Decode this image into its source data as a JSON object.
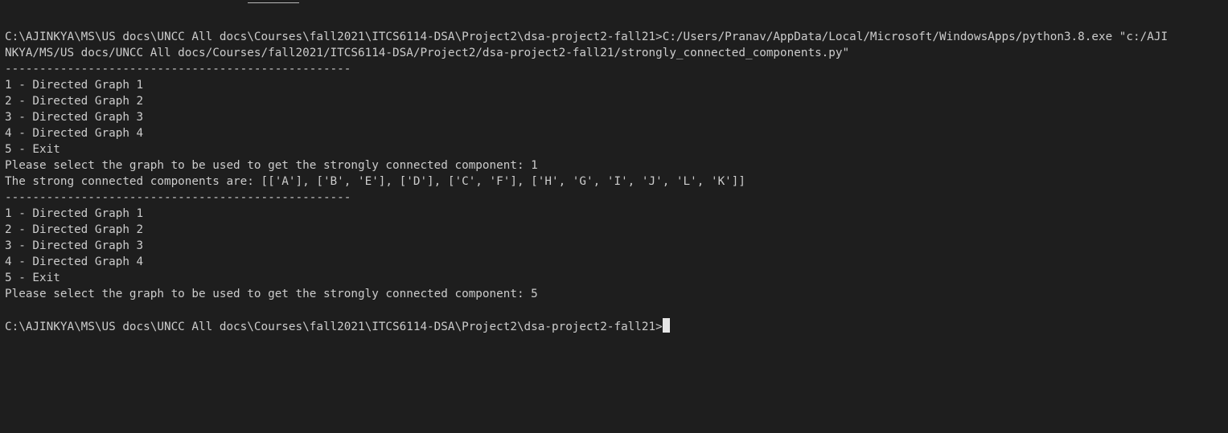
{
  "terminal": {
    "command_line_1": "C:\\AJINKYA\\MS\\US docs\\UNCC All docs\\Courses\\fall2021\\ITCS6114-DSA\\Project2\\dsa-project2-fall21>C:/Users/Pranav/AppData/Local/Microsoft/WindowsApps/python3.8.exe \"c:/AJI",
    "command_line_2": "NKYA/MS/US docs/UNCC All docs/Courses/fall2021/ITCS6114-DSA/Project2/dsa-project2-fall21/strongly_connected_components.py\"",
    "separator": "--------------------------------------------------",
    "menu_1": {
      "items": [
        "1 - Directed Graph 1",
        "2 - Directed Graph 2",
        "3 - Directed Graph 3",
        "4 - Directed Graph 4",
        "5 - Exit"
      ],
      "prompt": "Please select the graph to be used to get the strongly connected component: 1",
      "result": "The strong connected components are: [['A'], ['B', 'E'], ['D'], ['C', 'F'], ['H', 'G', 'I', 'J', 'L', 'K']]"
    },
    "menu_2": {
      "items": [
        "1 - Directed Graph 1",
        "2 - Directed Graph 2",
        "3 - Directed Graph 3",
        "4 - Directed Graph 4",
        "5 - Exit"
      ],
      "prompt": "Please select the graph to be used to get the strongly connected component: 5"
    },
    "final_prompt": "C:\\AJINKYA\\MS\\US docs\\UNCC All docs\\Courses\\fall2021\\ITCS6114-DSA\\Project2\\dsa-project2-fall21>"
  },
  "colors": {
    "background": "#1e1e1e",
    "text": "#cccccc",
    "cursor": "#e6e6e6"
  }
}
